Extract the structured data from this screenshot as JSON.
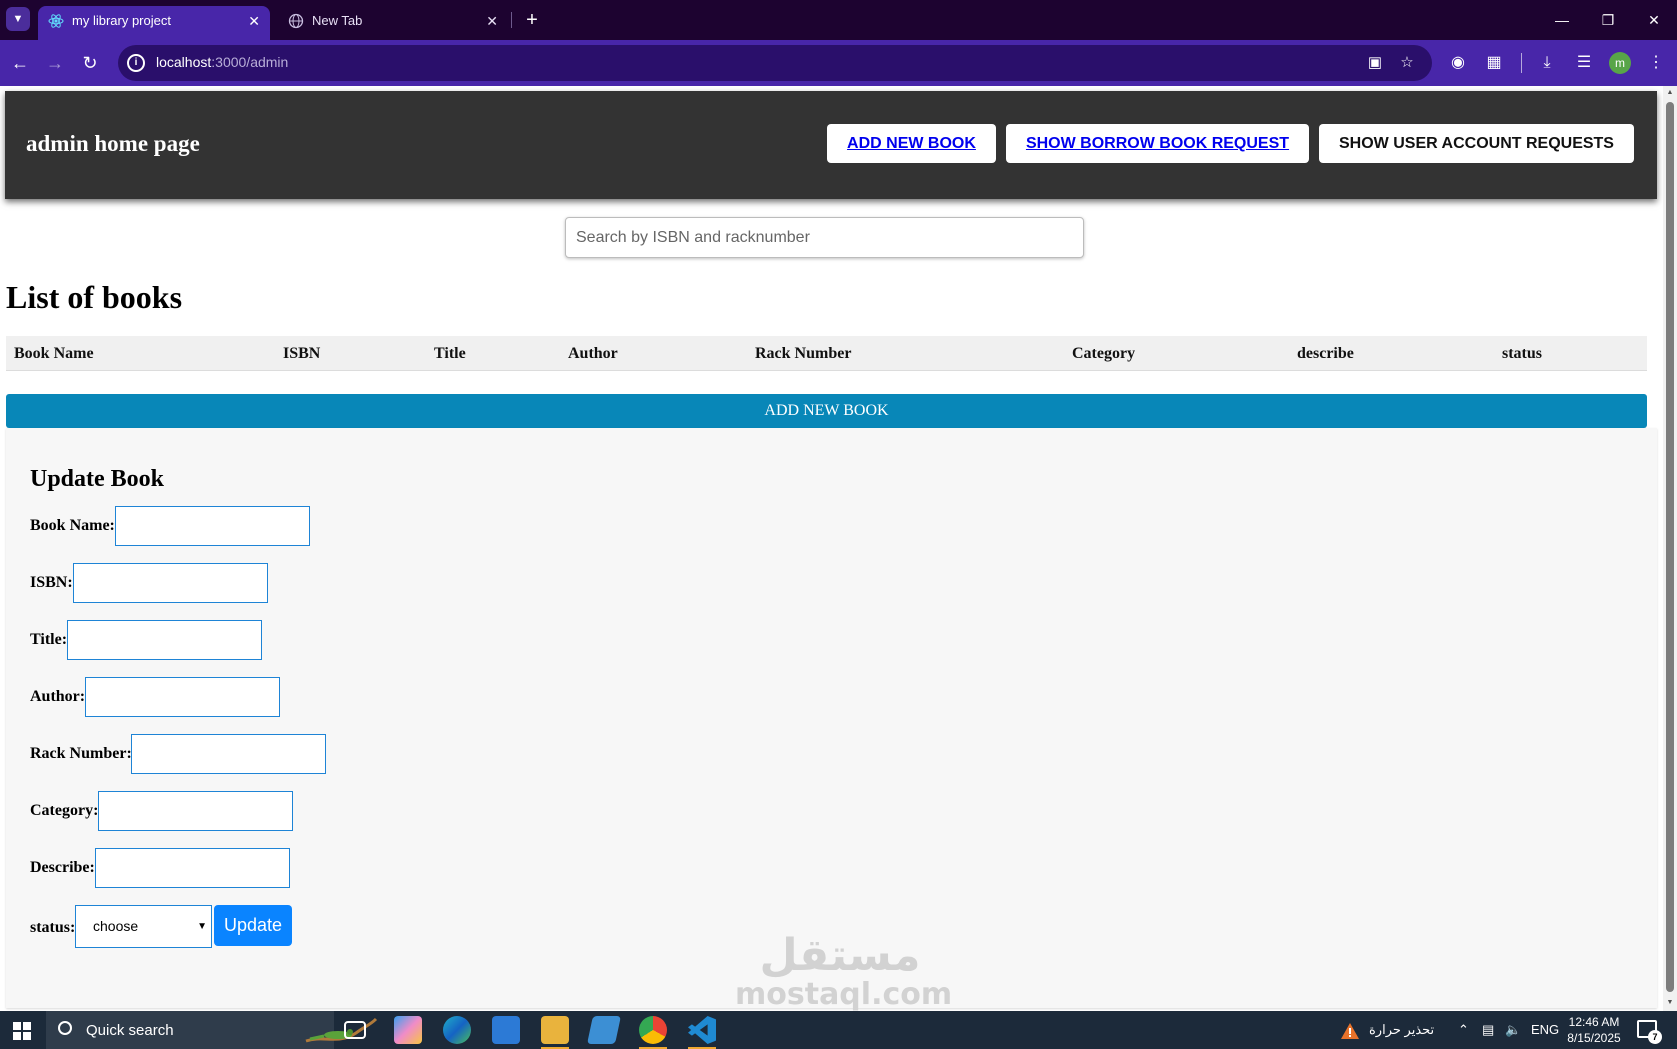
{
  "browser": {
    "tabs": [
      {
        "title": "my library project",
        "active": true
      },
      {
        "title": "New Tab",
        "active": false
      }
    ],
    "url_host": "localhost",
    "url_path": ":3000/admin",
    "avatar_letter": "m"
  },
  "header": {
    "title": "admin home page",
    "buttons": [
      {
        "label": "ADD NEW BOOK"
      },
      {
        "label": "SHOW BORROW BOOK REQUEST"
      },
      {
        "label": "SHOW USER ACCOUNT REQUESTS"
      }
    ]
  },
  "search": {
    "placeholder": "Search by ISBN and racknumber",
    "value": ""
  },
  "books": {
    "title": "List of books",
    "columns": [
      "Book Name",
      "ISBN",
      "Title",
      "Author",
      "Rack Number",
      "Category",
      "describe",
      "status"
    ],
    "rows": [],
    "add_label": "ADD NEW BOOK"
  },
  "update_form": {
    "title": "Update Book",
    "fields": [
      {
        "label": "Book Name:",
        "value": ""
      },
      {
        "label": "ISBN:",
        "value": ""
      },
      {
        "label": "Title:",
        "value": ""
      },
      {
        "label": "Author:",
        "value": ""
      },
      {
        "label": "Rack Number:",
        "value": ""
      },
      {
        "label": "Category:",
        "value": ""
      },
      {
        "label": "Describe:",
        "value": ""
      }
    ],
    "status_label": "status:",
    "status_selected": "choose",
    "submit_label": "Update"
  },
  "watermark": {
    "arabic": "مستقل",
    "latin": "mostaql.com"
  },
  "taskbar": {
    "search_text": "Quick search",
    "weather_alert": "تحذير حرارة",
    "language": "ENG",
    "time": "12:46 AM",
    "date": "8/15/2025",
    "notification_count": "7"
  },
  "colors": {
    "tab_strip": "#1d0330",
    "toolbar": "#4826a9",
    "header_bg": "#333333",
    "add_bar": "#0887b8",
    "input_border": "#1e84d6",
    "update_button": "#0a84ff"
  }
}
